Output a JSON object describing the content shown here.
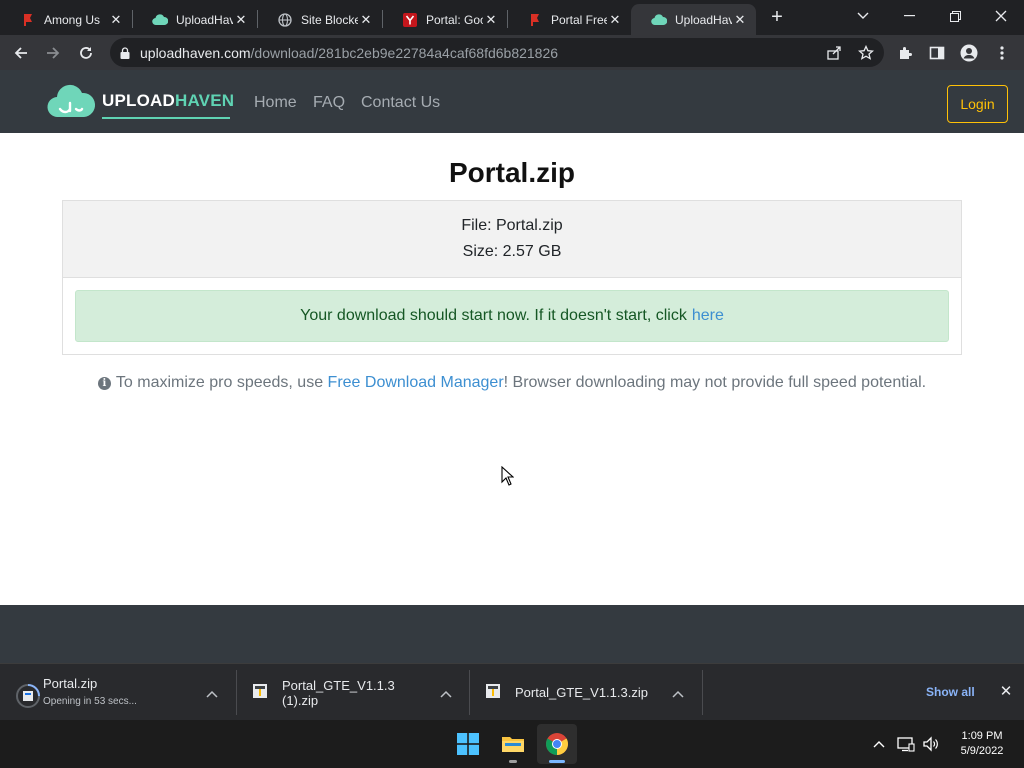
{
  "tabs": [
    {
      "title": "Among Us",
      "favicon": "red-flag-icon",
      "close": "✕"
    },
    {
      "title": "UploadHav",
      "favicon": "uploadhaven-cloud-icon",
      "close": "✕"
    },
    {
      "title": "Site Blocke",
      "favicon": "globe-icon",
      "close": "✕"
    },
    {
      "title": "Portal: Goo",
      "favicon": "y-logo-icon",
      "close": "✕"
    },
    {
      "title": "Portal Free",
      "favicon": "red-flag-icon",
      "close": "✕"
    },
    {
      "title": "UploadHav",
      "favicon": "uploadhaven-cloud-icon",
      "close": "✕",
      "active": true
    }
  ],
  "browser": {
    "url_host": "uploadhaven.com",
    "url_path": "/download/281bc2eb9e22784a4caf68fd6b821826"
  },
  "site": {
    "logo_upload": "UPLOAD",
    "logo_haven": "HAVEN",
    "nav": [
      "Home",
      "FAQ",
      "Contact Us"
    ],
    "login": "Login"
  },
  "main": {
    "title": "Portal.zip",
    "file_line": "File: Portal.zip",
    "size_line": "Size: 2.57 GB",
    "alert_text": "Your download should start now. If it doesn't start, click",
    "alert_link": "here",
    "info_before": "To maximize pro speeds, use",
    "info_link": "Free Download Manager",
    "info_after": "! Browser downloading may not provide full speed potential."
  },
  "downloads": {
    "items": [
      {
        "name": "Portal.zip",
        "status": "Opening in 53 secs..."
      },
      {
        "name": "Portal_GTE_V1.1.3 (1).zip",
        "status": ""
      },
      {
        "name": "Portal_GTE_V1.1.3.zip",
        "status": ""
      }
    ],
    "show_all": "Show all"
  },
  "taskbar": {
    "time": "1:09 PM",
    "date": "5/9/2022"
  },
  "colors": {
    "accent_teal": "#5fd3b3",
    "login_yellow": "#ffc107",
    "alert_green_bg": "#d4edda",
    "link_blue": "#3d8fd1"
  }
}
